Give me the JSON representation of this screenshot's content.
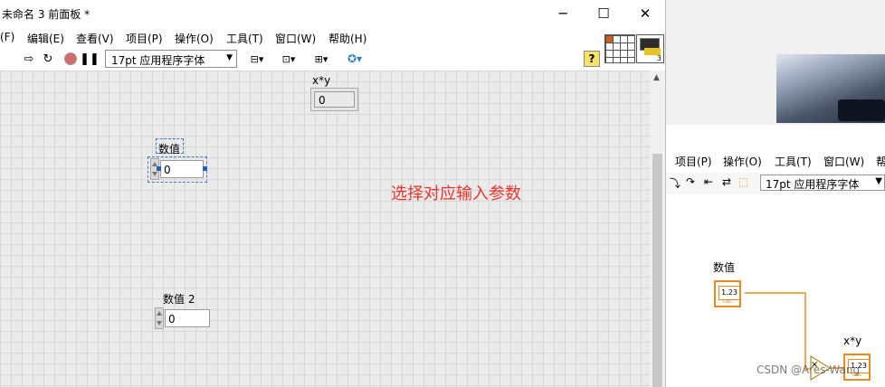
{
  "front_panel": {
    "title": "未命名 3 前面板 *",
    "menu": [
      "(F)",
      "编辑(E)",
      "查看(V)",
      "项目(P)",
      "操作(O)",
      "工具(T)",
      "窗口(W)",
      "帮助(H)"
    ],
    "font_select": "17pt 应用程序字体",
    "help_glyph": "?",
    "connector_count": "3",
    "controls": {
      "indicator_xy": {
        "label": "x*y",
        "value": "0"
      },
      "numeric": {
        "label": "数值",
        "value": "0"
      },
      "numeric2": {
        "label": "数值 2",
        "value": "0"
      }
    },
    "annotation": "选择对应输入参数",
    "annotation_color": "#e8352a"
  },
  "block_diagram": {
    "menu": [
      "项目(P)",
      "操作(O)",
      "工具(T)",
      "窗口(W)",
      "帮"
    ],
    "font_select": "17pt 应用程序字体",
    "terminals": {
      "numeric": {
        "label": "数值",
        "value": "1.23",
        "type": "DBL"
      },
      "result": {
        "label": "x*y",
        "value": "1.23",
        "type": "DBL"
      }
    },
    "multiply_symbol": "×",
    "wire_color": "#ea8a20"
  },
  "watermark": "CSDN @Ares-Wang"
}
